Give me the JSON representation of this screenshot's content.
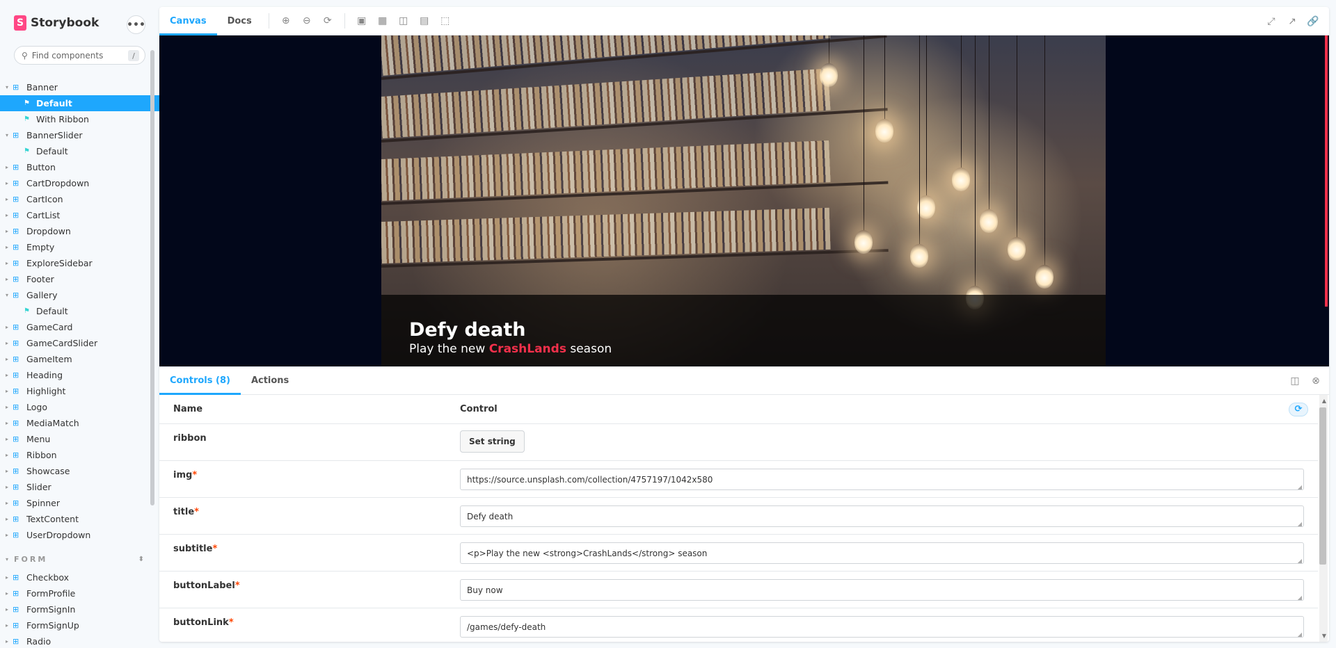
{
  "app": {
    "brand": "Storybook",
    "menu_glyph": "•••"
  },
  "search": {
    "placeholder": "Find components",
    "shortcut": "/"
  },
  "sidebar": {
    "items": [
      {
        "label": "Banner",
        "type": "component",
        "expanded": true
      },
      {
        "label": "Default",
        "type": "story",
        "selected": true
      },
      {
        "label": "With Ribbon",
        "type": "story"
      },
      {
        "label": "BannerSlider",
        "type": "component",
        "expanded": true
      },
      {
        "label": "Default",
        "type": "story"
      },
      {
        "label": "Button",
        "type": "component"
      },
      {
        "label": "CartDropdown",
        "type": "component"
      },
      {
        "label": "CartIcon",
        "type": "component"
      },
      {
        "label": "CartList",
        "type": "component"
      },
      {
        "label": "Dropdown",
        "type": "component"
      },
      {
        "label": "Empty",
        "type": "component"
      },
      {
        "label": "ExploreSidebar",
        "type": "component"
      },
      {
        "label": "Footer",
        "type": "component"
      },
      {
        "label": "Gallery",
        "type": "component",
        "expanded": true
      },
      {
        "label": "Default",
        "type": "story"
      },
      {
        "label": "GameCard",
        "type": "component"
      },
      {
        "label": "GameCardSlider",
        "type": "component"
      },
      {
        "label": "GameItem",
        "type": "component"
      },
      {
        "label": "Heading",
        "type": "component"
      },
      {
        "label": "Highlight",
        "type": "component"
      },
      {
        "label": "Logo",
        "type": "component"
      },
      {
        "label": "MediaMatch",
        "type": "component"
      },
      {
        "label": "Menu",
        "type": "component"
      },
      {
        "label": "Ribbon",
        "type": "component"
      },
      {
        "label": "Showcase",
        "type": "component"
      },
      {
        "label": "Slider",
        "type": "component"
      },
      {
        "label": "Spinner",
        "type": "component"
      },
      {
        "label": "TextContent",
        "type": "component"
      },
      {
        "label": "UserDropdown",
        "type": "component"
      }
    ],
    "section_title": "FORM",
    "form_items": [
      {
        "label": "Checkbox"
      },
      {
        "label": "FormProfile"
      },
      {
        "label": "FormSignIn"
      },
      {
        "label": "FormSignUp"
      },
      {
        "label": "Radio"
      }
    ]
  },
  "toolbar": {
    "tab_canvas": "Canvas",
    "tab_docs": "Docs"
  },
  "banner": {
    "title": "Defy death",
    "subtitle_prefix": "Play the new ",
    "subtitle_highlight": "CrashLands",
    "subtitle_suffix": " season",
    "highlight_color": "#f2304b"
  },
  "addons": {
    "tab_controls": "Controls (8)",
    "tab_actions": "Actions",
    "header_name": "Name",
    "header_control": "Control",
    "rows": [
      {
        "name": "ribbon",
        "required": false,
        "control": "button",
        "value": "Set string"
      },
      {
        "name": "img",
        "required": true,
        "control": "text",
        "value": "https://source.unsplash.com/collection/4757197/1042x580"
      },
      {
        "name": "title",
        "required": true,
        "control": "text",
        "value": "Defy death"
      },
      {
        "name": "subtitle",
        "required": true,
        "control": "text",
        "value": "<p>Play the new <strong>CrashLands</strong> season"
      },
      {
        "name": "buttonLabel",
        "required": true,
        "control": "text",
        "value": "Buy now"
      },
      {
        "name": "buttonLink",
        "required": true,
        "control": "text",
        "value": "/games/defy-death"
      }
    ]
  },
  "colors": {
    "accent": "#1ea7fd",
    "brand": "#ff4785",
    "required": "#ff4400"
  }
}
